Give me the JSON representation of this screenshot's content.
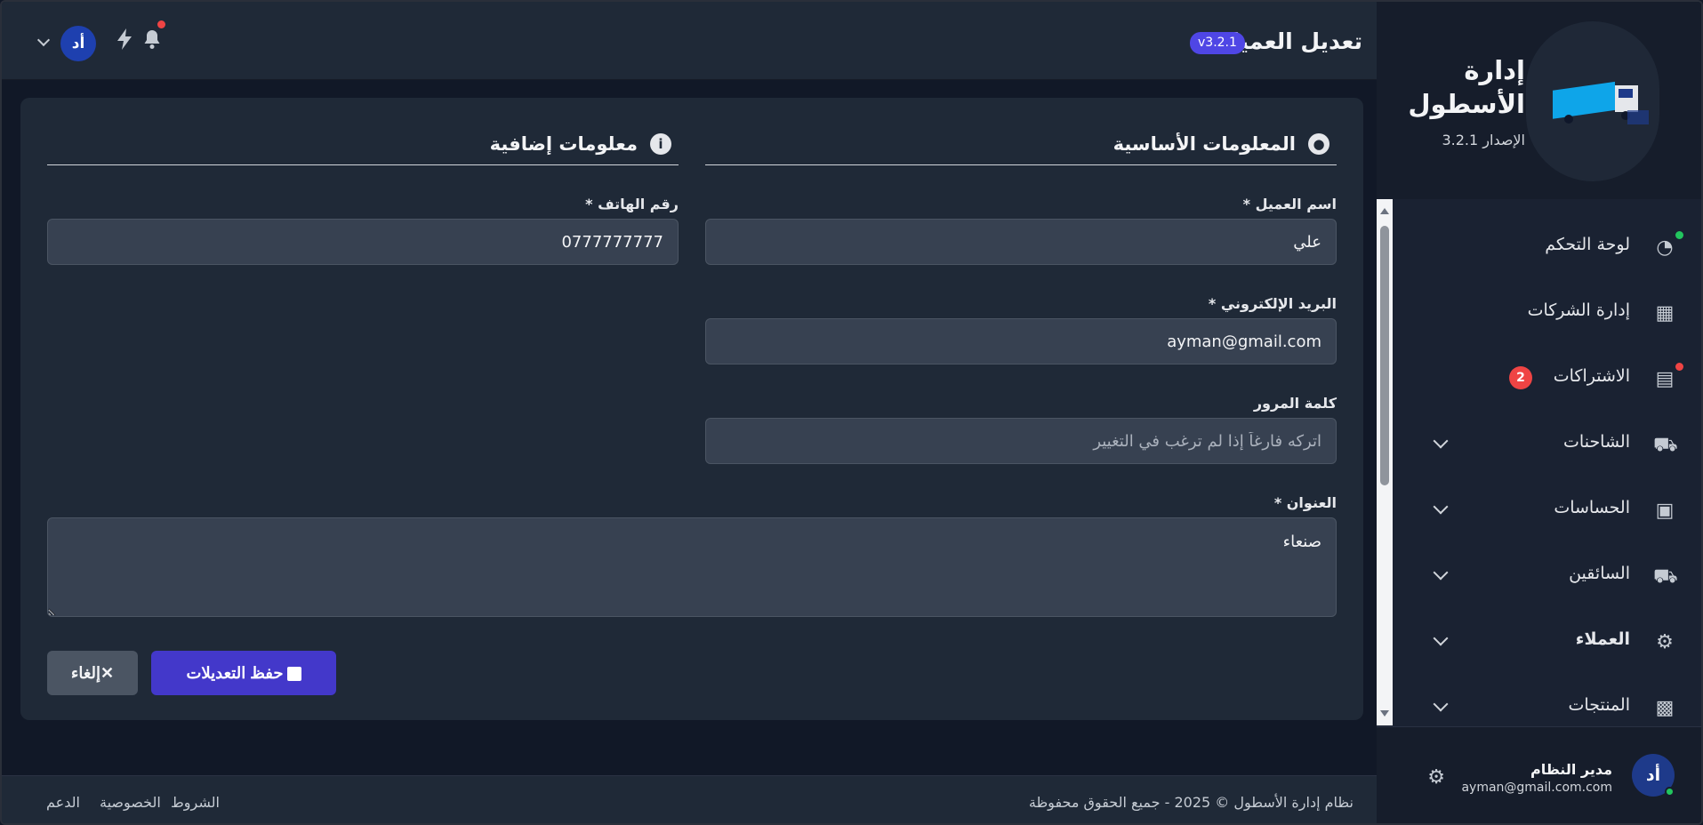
{
  "header": {
    "title": "تعديل العميل",
    "version_badge": "v3.2.1",
    "avatar_initials": "أد"
  },
  "brand": {
    "title": "إدارة الأسطول",
    "version": "الإصدار 3.2.1"
  },
  "sidebar": {
    "items": [
      {
        "label": "لوحة التحكم",
        "icon": "gauge-icon"
      },
      {
        "label": "إدارة الشركات",
        "icon": "building-icon"
      },
      {
        "label": "الاشتراكات",
        "icon": "invoice-icon",
        "badge": "2"
      },
      {
        "label": "الشاحنات",
        "icon": "truck-icon"
      },
      {
        "label": "الحساسات",
        "icon": "chip-icon"
      },
      {
        "label": "السائقين",
        "icon": "truck-icon"
      },
      {
        "label": "العملاء",
        "icon": "users-gear-icon"
      },
      {
        "label": "المنتجات",
        "icon": "boxes-icon"
      }
    ]
  },
  "user": {
    "initials": "أد",
    "name": "مدير النظام",
    "email": "ayman@gmail.com.com"
  },
  "form": {
    "basic_section": "المعلومات الأساسية",
    "extra_section": "معلومات إضافية",
    "name_label": "اسم العميل *",
    "name_value": "علي",
    "phone_label": "رقم الهاتف *",
    "phone_value": "0777777777",
    "email_label": "البريد الإلكتروني *",
    "email_value": "ayman@gmail.com",
    "password_label": "كلمة المرور",
    "password_placeholder": "اتركه فارغاً إذا لم ترغب في التغيير",
    "address_label": "العنوان *",
    "address_value": "صنعاء",
    "save_label": "حفظ التعديلات",
    "cancel_label": "إلغاء"
  },
  "footer": {
    "copyright": "نظام إدارة الأسطول © 2025 - جميع الحقوق محفوظة",
    "links": [
      "الدعم",
      "الخصوصية",
      "الشروط"
    ]
  },
  "colors": {
    "accent": "#4338ca",
    "badge": "#4f46e5",
    "danger": "#ef4444",
    "online": "#22c55e"
  }
}
